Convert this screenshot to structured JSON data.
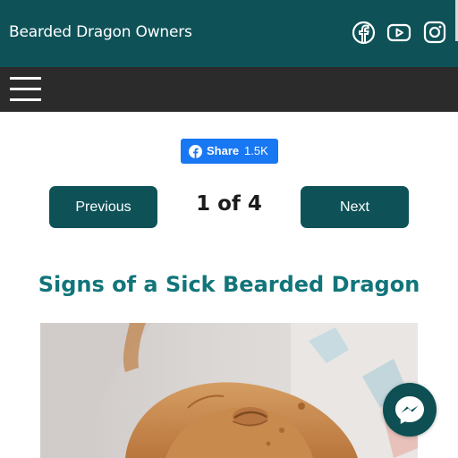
{
  "header": {
    "site_title": "Bearded Dragon Owners",
    "social_icons": [
      "facebook-icon",
      "youtube-icon",
      "instagram-icon"
    ]
  },
  "nav": {
    "menu_icon": "hamburger-menu-icon"
  },
  "share": {
    "label": "Share",
    "count": "1.5K"
  },
  "pagination": {
    "previous_label": "Previous",
    "next_label": "Next",
    "current": "1 of 4"
  },
  "article": {
    "title": "Signs of a Sick Bearded Dragon"
  },
  "chat": {
    "icon": "messenger-icon"
  },
  "colors": {
    "header_bg": "#0e5258",
    "nav_bg": "#2b2b2b",
    "button_bg": "#0e5258",
    "title_color": "#11757a",
    "facebook_blue": "#1877f2"
  }
}
